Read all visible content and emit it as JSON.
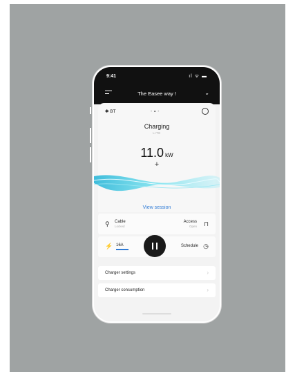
{
  "status_bar": {
    "time": "9:41",
    "icons": "ıl ᯤ ▬"
  },
  "header": {
    "title": "The Easee way !",
    "chevron": "⌄"
  },
  "card": {
    "bluetooth_label": "BT",
    "bluetooth_icon": "✱",
    "page_dots": [
      "•",
      "•",
      "•"
    ],
    "status_title": "Charging",
    "status_sub": "LITE",
    "power_value": "11.0",
    "power_unit": "kW",
    "plus": "+"
  },
  "view_session": "View session",
  "cable": {
    "label": "Cable",
    "state": "Locked",
    "icon": "⚲"
  },
  "access": {
    "label": "Access",
    "state": "Open",
    "icon": "⊓"
  },
  "current": {
    "label": "16A",
    "icon": "⚡"
  },
  "schedule": {
    "label": "Schedule",
    "icon": "◷"
  },
  "list": [
    {
      "label": "Charger settings",
      "chevron": "›"
    },
    {
      "label": "Charger consumption",
      "chevron": "›"
    }
  ],
  "colors": {
    "accent": "#2f7bd6",
    "background": "#9fa3a3",
    "header": "#111111",
    "wave": "#5fd4e6"
  }
}
